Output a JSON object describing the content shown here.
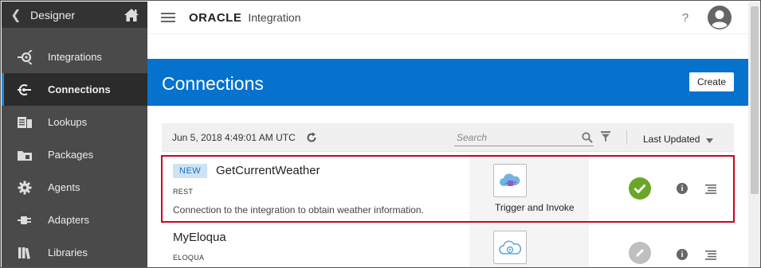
{
  "sidebar": {
    "title": "Designer",
    "items": [
      {
        "label": "Integrations",
        "icon": "integrations-icon",
        "active": false
      },
      {
        "label": "Connections",
        "icon": "connections-icon",
        "active": true
      },
      {
        "label": "Lookups",
        "icon": "lookups-icon",
        "active": false
      },
      {
        "label": "Packages",
        "icon": "packages-icon",
        "active": false
      },
      {
        "label": "Agents",
        "icon": "agents-gear-icon",
        "active": false
      },
      {
        "label": "Adapters",
        "icon": "adapters-plug-icon",
        "active": false
      },
      {
        "label": "Libraries",
        "icon": "libraries-icon",
        "active": false
      }
    ]
  },
  "header": {
    "brand": "ORACLE",
    "product": "Integration",
    "help": "?"
  },
  "page": {
    "title": "Connections",
    "create_label": "Create"
  },
  "filter": {
    "timestamp": "Jun 5, 2018 4:49:01 AM UTC",
    "search_placeholder": "Search",
    "sort_label": "Last Updated"
  },
  "connections": [
    {
      "badge": "NEW",
      "name": "GetCurrentWeather",
      "type": "REST",
      "description": "Connection to the integration to obtain weather information.",
      "role": "Trigger and Invoke",
      "status": "configured",
      "status_color": "#6aa628"
    },
    {
      "badge": "",
      "name": "MyEloqua",
      "type": "ELOQUA",
      "description": "",
      "role": "",
      "status": "draft",
      "status_color": "#bfbfbf"
    }
  ],
  "colors": {
    "banner": "#0572ce",
    "sidebar": "#4a4a4a",
    "highlight": "#d0021b"
  }
}
